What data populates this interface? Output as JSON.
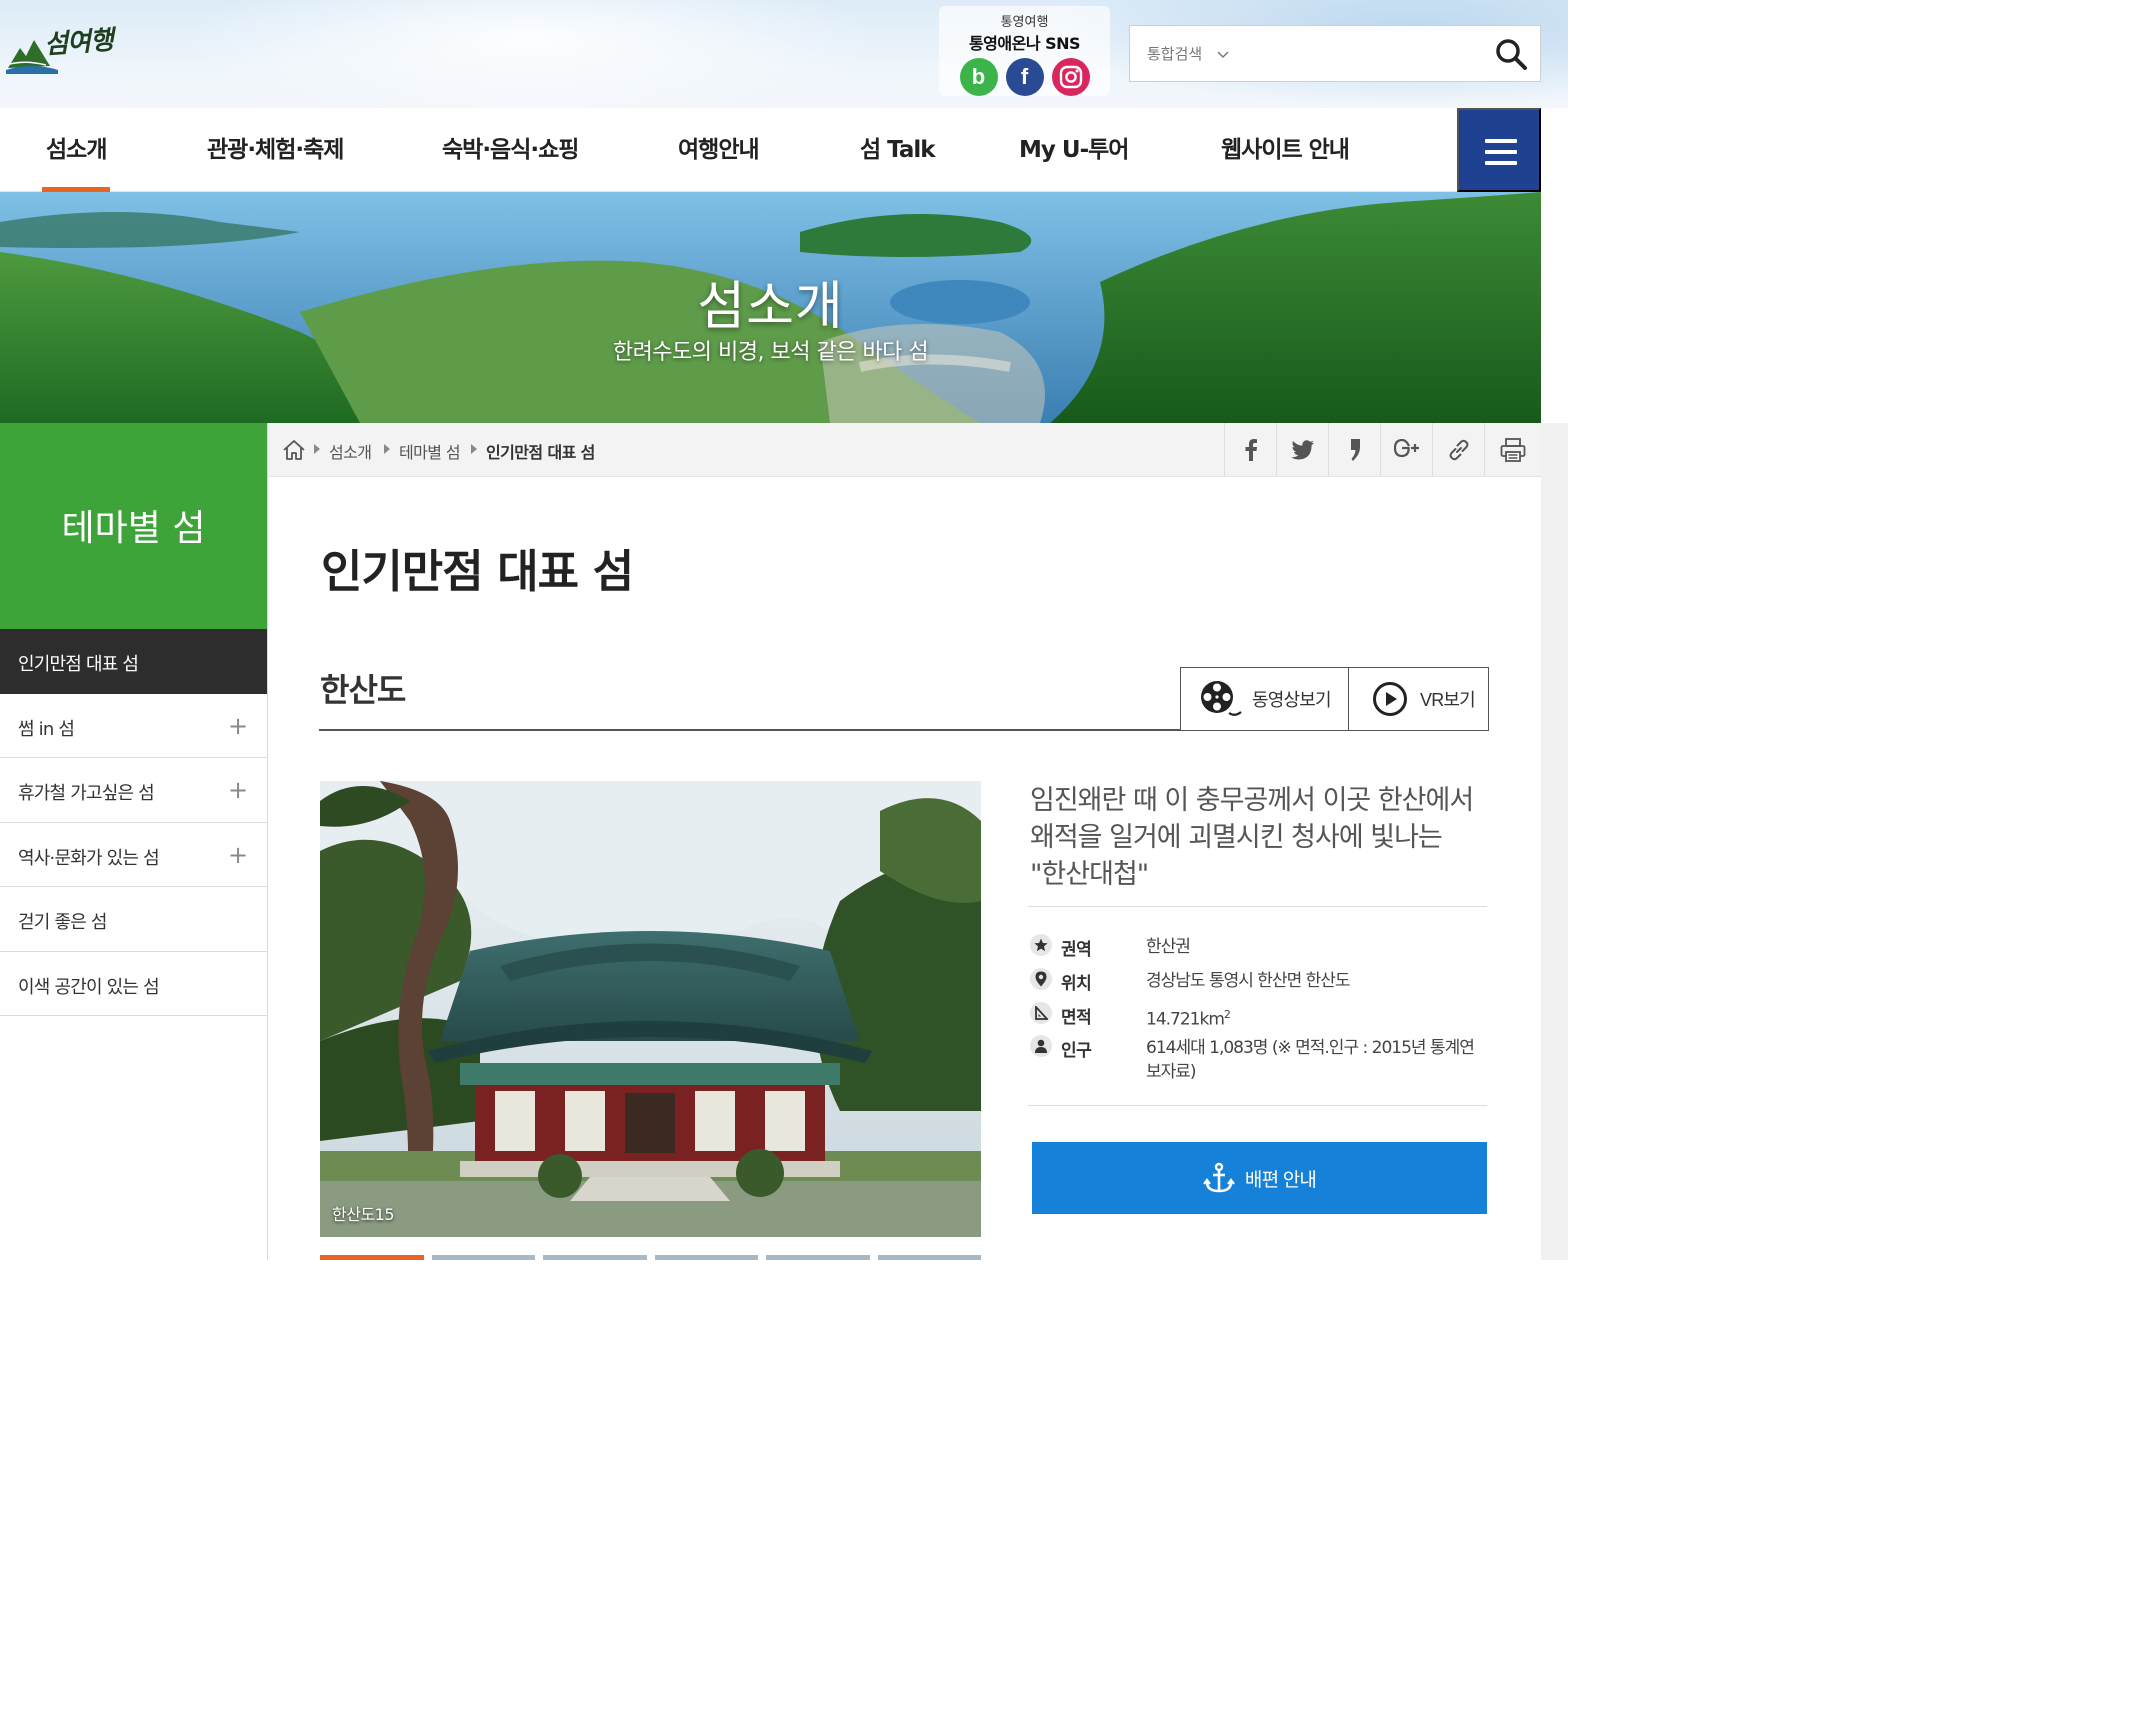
{
  "site": {
    "logo_text": "섬여행"
  },
  "sns": {
    "small": "통영여행",
    "title": "통영애온나 SNS",
    "blog_glyph": "b",
    "facebook_glyph": "f"
  },
  "search": {
    "select_label": "통합검색",
    "placeholder": ""
  },
  "gnb": [
    {
      "label": "섬소개",
      "active": true
    },
    {
      "label": "관광·체험·축제"
    },
    {
      "label": "숙박·음식·쇼핑"
    },
    {
      "label": "여행안내"
    },
    {
      "label": "섬 Talk"
    },
    {
      "label": "My U-투어"
    },
    {
      "label": "웹사이트 안내"
    }
  ],
  "banner": {
    "title": "섬소개",
    "subtitle": "한려수도의 비경, 보석 같은 바다 섬"
  },
  "sidebar": {
    "title": "테마별 섬",
    "items": [
      {
        "label": "인기만점 대표 섬",
        "active": true
      },
      {
        "label": "썸 in 섬",
        "expand": "+"
      },
      {
        "label": "휴가철 가고싶은 섬",
        "expand": "+"
      },
      {
        "label": "역사·문화가 있는 섬",
        "expand": "+"
      },
      {
        "label": "걷기 좋은 섬"
      },
      {
        "label": "이색 공간이 있는 섬"
      }
    ]
  },
  "breadcrumb": {
    "items": [
      "섬소개",
      "테마별 섬",
      "인기만점 대표 섬"
    ]
  },
  "page": {
    "title": "인기만점 대표 섬"
  },
  "island": {
    "name": "한산도",
    "video_label": "동영상보기",
    "vr_label": "VR보기",
    "photo_caption": "한산도15",
    "description": "임진왜란 때 이 충무공께서 이곳 한산에서 왜적을 일거에 괴멸시킨 청사에 빛나는 \"한산대첩\"",
    "info": [
      {
        "icon": "star-icon",
        "key": "권역",
        "value": "한산권"
      },
      {
        "icon": "location-pin-icon",
        "key": "위치",
        "value": "경상남도 통영시 한산면 한산도"
      },
      {
        "icon": "area-icon",
        "key": "면적",
        "value": "14.721km",
        "sup": "2"
      },
      {
        "icon": "person-icon",
        "key": "인구",
        "value": "614세대 1,083명 (※ 면적.인구 : 2015년 통계연보자료)"
      }
    ],
    "ferry_label": "배편 안내"
  },
  "colors": {
    "accent_orange": "#e96421",
    "nav_blue": "#1f4191",
    "green": "#3ea43a",
    "ferry_blue": "#1681d8"
  }
}
